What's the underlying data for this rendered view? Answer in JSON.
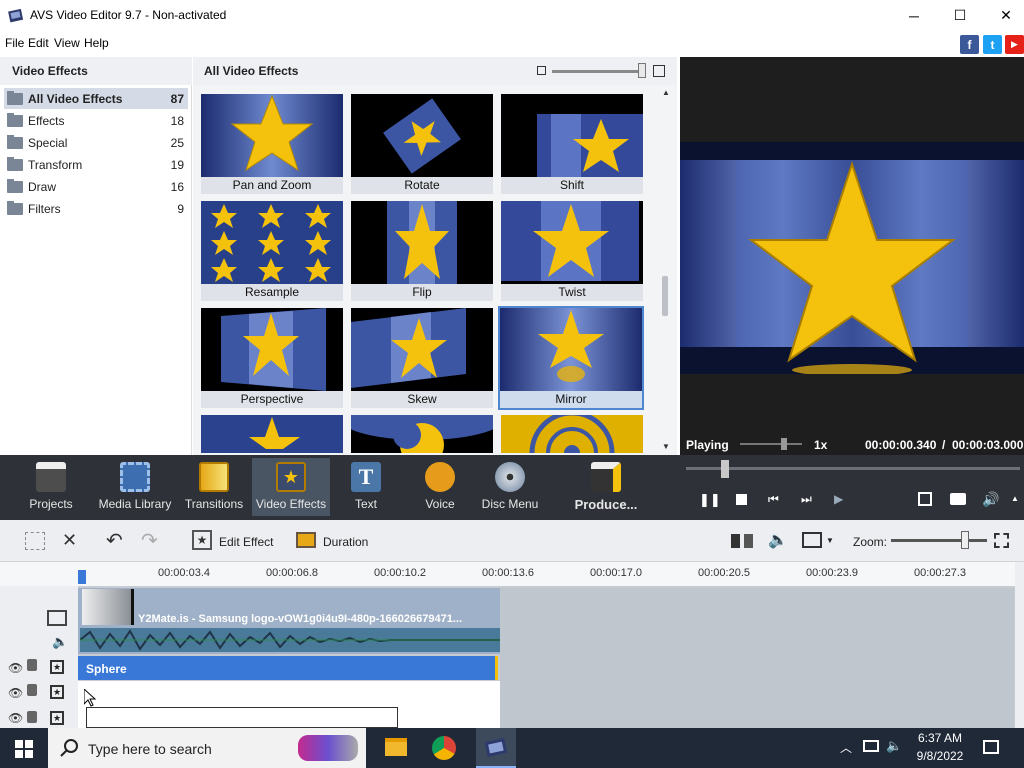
{
  "window": {
    "title": "AVS Video Editor 9.7 - Non-activated",
    "minimize": "─",
    "maximize": "☐",
    "close": "✕"
  },
  "menu": [
    "File",
    "Edit",
    "View",
    "Help"
  ],
  "social": {
    "facebook": "f",
    "twitter": "t",
    "youtube": "▶"
  },
  "left_panel": {
    "title": "Video Effects",
    "categories": [
      {
        "label": "All Video Effects",
        "count": "87"
      },
      {
        "label": "Effects",
        "count": "18"
      },
      {
        "label": "Special",
        "count": "25"
      },
      {
        "label": "Transform",
        "count": "19"
      },
      {
        "label": "Draw",
        "count": "16"
      },
      {
        "label": "Filters",
        "count": "9"
      }
    ]
  },
  "grid_panel": {
    "title": "All Video Effects",
    "effects": [
      "Pan and Zoom",
      "Rotate",
      "Shift",
      "Resample",
      "Flip",
      "Twist",
      "Perspective",
      "Skew",
      "Mirror"
    ]
  },
  "preview": {
    "status": "Playing",
    "speed": "1x",
    "time_current": "00:00:00.340",
    "time_separator": "/",
    "time_total": "00:00:03.000"
  },
  "toolbar": [
    "Projects",
    "Media Library",
    "Transitions",
    "Video Effects",
    "Text",
    "Voice",
    "Disc Menu",
    "Produce..."
  ],
  "edit": {
    "edit_effect": "Edit Effect",
    "duration": "Duration",
    "zoom": "Zoom:"
  },
  "timeline": {
    "ticks": [
      "00:00:03.4",
      "00:00:06.8",
      "00:00:10.2",
      "00:00:13.6",
      "00:00:17.0",
      "00:00:20.5",
      "00:00:23.9",
      "00:00:27.3"
    ],
    "clip_name": "Y2Mate.is - Samsung logo-vOW1g0i4u9I-480p-166026679471...",
    "effect_name": "Sphere"
  },
  "taskbar": {
    "search_placeholder": "Type here to search",
    "time": "6:37 AM",
    "date": "9/8/2022"
  },
  "colors": {
    "accent": "#3a78d8",
    "toolbar_bg": "#2e3238",
    "star": "#f4c20d"
  }
}
